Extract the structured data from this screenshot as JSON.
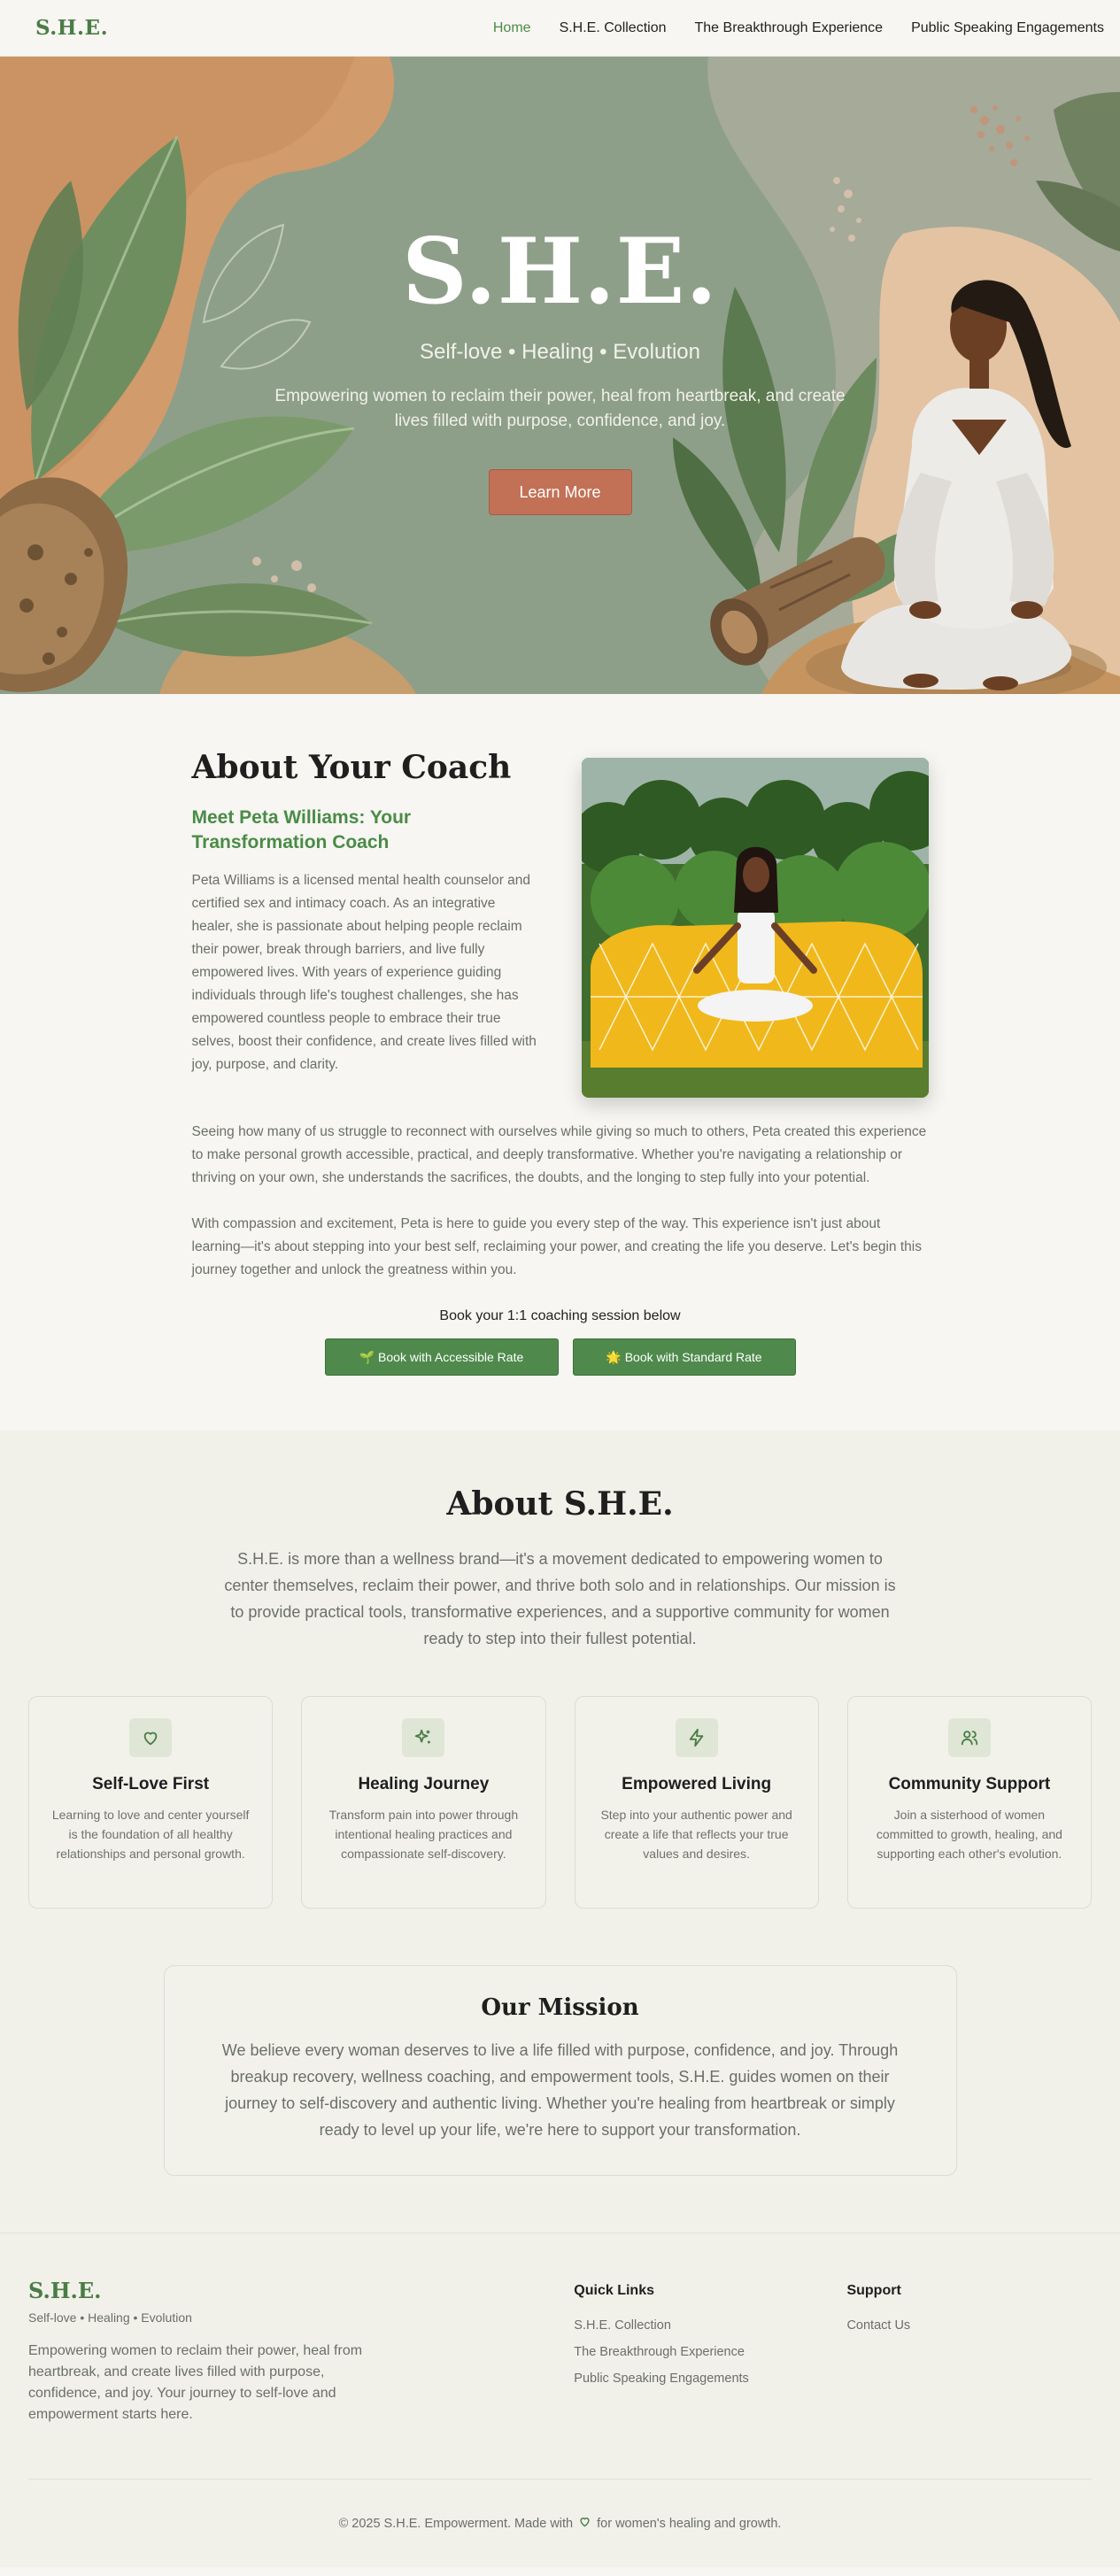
{
  "nav": {
    "logo": "S.H.E.",
    "links": [
      "Home",
      "S.H.E. Collection",
      "The Breakthrough Experience",
      "Public Speaking Engagements"
    ]
  },
  "hero": {
    "title": "S.H.E.",
    "tagline": "Self-love • Healing • Evolution",
    "description": "Empowering women to reclaim their power, heal from heartbreak, and create lives filled with purpose, confidence, and joy.",
    "button": "Learn More"
  },
  "coach": {
    "heading": "About Your Coach",
    "subheading": "Meet Peta Williams: Your Transformation Coach",
    "bio": "Peta Williams is a licensed mental health counselor and certified sex and intimacy coach. As an integrative healer, she is passionate about helping people reclaim their power, break through barriers, and live fully empowered lives. With years of experience guiding individuals through life's toughest challenges, she has empowered countless people to embrace their true selves, boost their confidence, and create lives filled with joy, purpose, and clarity.",
    "para1": "Seeing how many of us struggle to reconnect with ourselves while giving so much to others, Peta created this experience to make personal growth accessible, practical, and deeply transformative. Whether you're navigating a relationship or thriving on your own, she understands the sacrifices, the doubts, and the longing to step fully into your potential.",
    "para2": "With compassion and excitement, Peta is here to guide you every step of the way. This experience isn't just about learning—it's about stepping into your best self, reclaiming your power, and creating the life you deserve. Let's begin this journey together and unlock the greatness within you.",
    "book_heading": "Book your 1:1 coaching session below",
    "book_accessible": "🌱 Book with Accessible Rate",
    "book_standard": "🌟 Book with Standard Rate"
  },
  "about": {
    "heading": "About S.H.E.",
    "description": "S.H.E. is more than a wellness brand—it's a movement dedicated to empowering women to center themselves, reclaim their power, and thrive both solo and in relationships. Our mission is to provide practical tools, transformative experiences, and a supportive community for women ready to step into their fullest potential.",
    "cards": [
      {
        "icon": "heart-icon",
        "title": "Self-Love First",
        "text": "Learning to love and center yourself is the foundation of all healthy relationships and personal growth."
      },
      {
        "icon": "sparkles-icon",
        "title": "Healing Journey",
        "text": "Transform pain into power through intentional healing practices and compassionate self-discovery."
      },
      {
        "icon": "lightning-icon",
        "title": "Empowered Living",
        "text": "Step into your authentic power and create a life that reflects your true values and desires."
      },
      {
        "icon": "users-icon",
        "title": "Community Support",
        "text": "Join a sisterhood of women committed to growth, healing, and supporting each other's evolution."
      }
    ],
    "mission_heading": "Our Mission",
    "mission_text": "We believe every woman deserves to live a life filled with purpose, confidence, and joy. Through breakup recovery, wellness coaching, and empowerment tools, S.H.E. guides women on their journey to self-discovery and authentic living. Whether you're healing from heartbreak or simply ready to level up your life, we're here to support your transformation."
  },
  "footer": {
    "logo": "S.H.E.",
    "tagline": "Self-love • Healing • Evolution",
    "description": "Empowering women to reclaim their power, heal from heartbreak, and create lives filled with purpose, confidence, and joy. Your journey to self-love and empowerment starts here.",
    "quick_links_heading": "Quick Links",
    "quick_links": [
      "S.H.E. Collection",
      "The Breakthrough Experience",
      "Public Speaking Engagements"
    ],
    "support_heading": "Support",
    "support_links": [
      "Contact Us"
    ],
    "copyright_prefix": "© 2025 S.H.E. Empowerment. Made with",
    "copyright_suffix": "for women's healing and growth."
  },
  "colors": {
    "brand_green": "#4a7d46",
    "accent_terracotta": "#c27156",
    "hero_sage": "#8e9f89"
  }
}
